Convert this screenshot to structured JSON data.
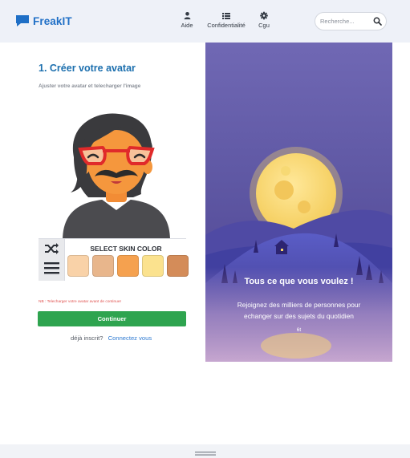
{
  "header": {
    "brand": "FreakIT",
    "nav": [
      {
        "label": "Aide",
        "icon": "user-icon"
      },
      {
        "label": "Confidentialité",
        "icon": "list-icon"
      },
      {
        "label": "Cgu",
        "icon": "gear-icon"
      }
    ],
    "search_placeholder": "Recherche..."
  },
  "avatar_step": {
    "title": "1. Créer votre avatar",
    "subtitle": "Ajuster votre avatar et telecharger l'image",
    "skin_picker_label": "SELECT SKIN COLOR",
    "skin_colors": [
      "#f9d2a8",
      "#e8b68c",
      "#f5a14f",
      "#fbe28e",
      "#d48c59"
    ],
    "tools": [
      "shuffle-icon",
      "menu-icon"
    ],
    "warning": "NB : Telecharger votre avatar avant de continuer",
    "continue_label": "Continuer",
    "login_prompt": "déjà inscrit?",
    "login_link": "Connectez vous"
  },
  "hero": {
    "title": "Tous ce que vous voulez !",
    "text": "Rejoignez des milliers de personnes pour echanger sur des sujets du quotidien",
    "small": "6t"
  },
  "colors": {
    "brand": "#1f6fc6",
    "continue": "#2ea44f",
    "title": "#1c6fae",
    "warning": "#e0524f",
    "link": "#2e7ad1"
  }
}
